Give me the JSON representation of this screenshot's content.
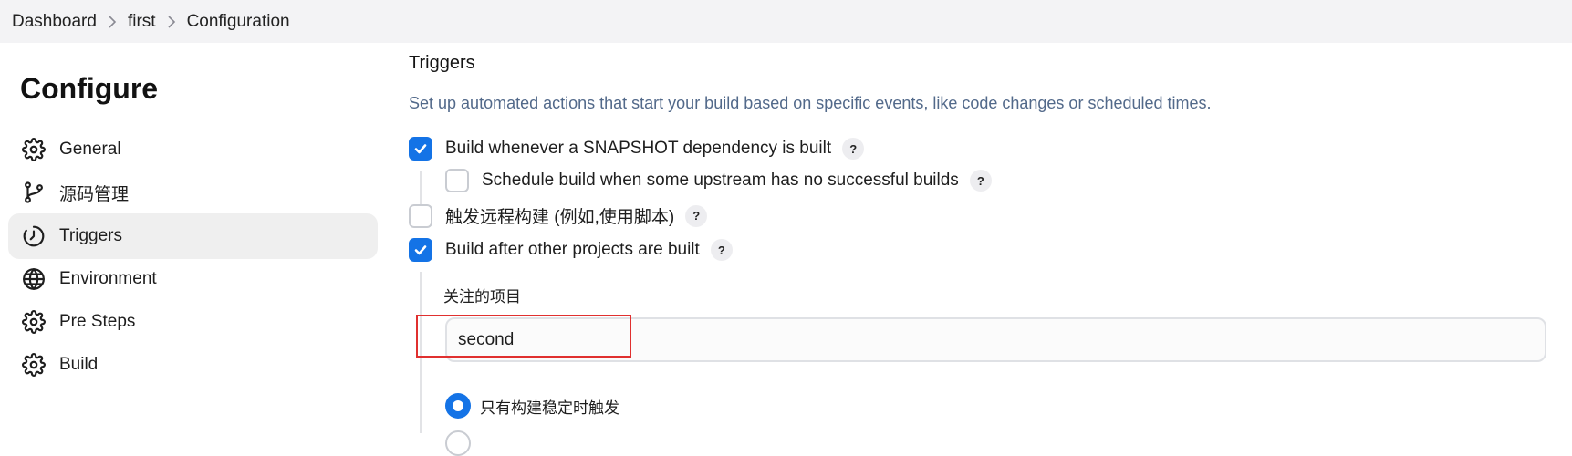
{
  "breadcrumb": {
    "items": [
      "Dashboard",
      "first",
      "Configuration"
    ]
  },
  "sidebar": {
    "title": "Configure",
    "items": [
      {
        "label": "General",
        "icon": "gear-icon",
        "active": false
      },
      {
        "label": "源码管理",
        "icon": "branch-icon",
        "active": false
      },
      {
        "label": "Triggers",
        "icon": "clock-icon",
        "active": true
      },
      {
        "label": "Environment",
        "icon": "globe-icon",
        "active": false
      },
      {
        "label": "Pre Steps",
        "icon": "gear-icon",
        "active": false
      },
      {
        "label": "Build",
        "icon": "gear-icon",
        "active": false
      }
    ]
  },
  "main": {
    "section_title": "Triggers",
    "section_description": "Set up automated actions that start your build based on specific events, like code changes or scheduled times.",
    "options": [
      {
        "label": "Build whenever a SNAPSHOT dependency is built",
        "checked": true
      },
      {
        "label": "Schedule build when some upstream has no successful builds",
        "checked": false
      },
      {
        "label": "触发远程构建 (例如,使用脚本)",
        "checked": false
      },
      {
        "label": "Build after other projects are built",
        "checked": true
      }
    ],
    "help_label": "?",
    "projects_field": {
      "label": "关注的项目",
      "value": "second"
    },
    "radio_options": [
      {
        "label": "只有构建稳定时触发",
        "selected": true
      }
    ]
  },
  "colors": {
    "accent": "#1473e6",
    "highlight": "#e0302f",
    "description_text": "#52698a"
  }
}
